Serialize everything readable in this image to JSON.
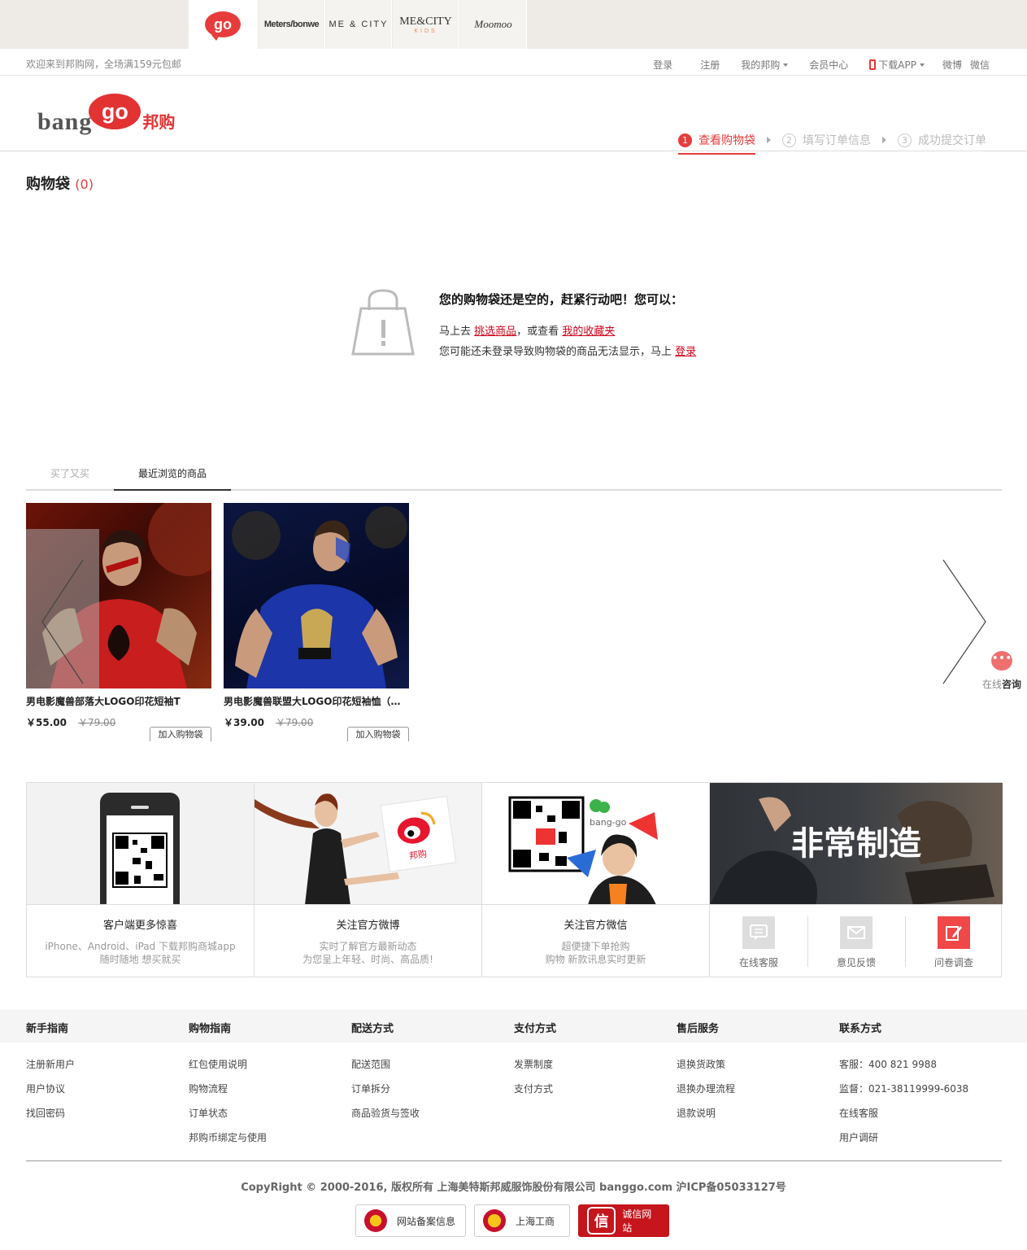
{
  "brands": {
    "go": "go",
    "metersbonwe": "Meters/bonwe",
    "mecity": "ME & CITY",
    "mecity_kids": "ME&CITY",
    "kids_sub": "KIDS",
    "moomoo": "Moomoo"
  },
  "topbar": {
    "welcome": "欢迎来到邦购网，全场满159元包邮",
    "login": "登录",
    "register": "注册",
    "my_banggo": "我的邦购",
    "member_center": "会员中心",
    "download_app": "下载APP",
    "weibo": "微博",
    "weixin": "微信"
  },
  "header": {
    "logo_bang": "bang",
    "logo_go": "go",
    "logo_cn": "邦购",
    "steps": [
      {
        "num": "1",
        "label": "查看购物袋"
      },
      {
        "num": "2",
        "label": "填写订单信息"
      },
      {
        "num": "3",
        "label": "成功提交订单"
      }
    ]
  },
  "cart": {
    "title": "购物袋",
    "count": "(0)",
    "empty_title": "您的购物袋还是空的，赶紧行动吧！您可以：",
    "line1_prefix": "马上去",
    "line1_link1": "挑选商品",
    "line1_mid": "，或查看",
    "line1_link2": "我的收藏夹",
    "line2_prefix": "您可能还未登录导致购物袋的商品无法显示，马上",
    "line2_link": "登录"
  },
  "recommend": {
    "tab_bought": "买了又买",
    "tab_recent": "最近浏览的商品",
    "add_to_cart": "加入购物袋",
    "products": [
      {
        "name": "男电影魔兽部落大LOGO印花短袖T",
        "price": "￥55.00",
        "old_price": "￥79.00"
      },
      {
        "name": "男电影魔兽联盟大LOGO印花短袖恤（预...",
        "price": "￥39.00",
        "old_price": "￥79.00"
      }
    ]
  },
  "chat": {
    "label_a": "在线",
    "label_b": "咨询"
  },
  "promo": {
    "app_title": "客户端更多惊喜",
    "app_desc1": "iPhone、Android、iPad 下载邦购商城app",
    "app_desc2": "随时随地 想买就买",
    "weibo_title": "关注官方微博",
    "weibo_desc1": "实时了解官方最新动态",
    "weibo_desc2": "为您呈上年轻、时尚、高品质!",
    "weibo_card": "邦购",
    "wechat_title": "关注官方微信",
    "wechat_desc1": "超便捷下单抢购",
    "wechat_desc2": "购物 新款讯息实时更新",
    "wechat_handle": "bang-go",
    "made_text": "非常制造",
    "svc_online": "在线客服",
    "svc_feedback": "意见反馈",
    "svc_survey": "问卷调查"
  },
  "footer": {
    "cols": [
      {
        "title": "新手指南",
        "links": [
          "注册新用户",
          "用户协议",
          "找回密码"
        ]
      },
      {
        "title": "购物指南",
        "links": [
          "红包使用说明",
          "购物流程",
          "订单状态",
          "邦购币绑定与使用"
        ]
      },
      {
        "title": "配送方式",
        "links": [
          "配送范围",
          "订单拆分",
          "商品验货与签收"
        ]
      },
      {
        "title": "支付方式",
        "links": [
          "发票制度",
          "支付方式"
        ]
      },
      {
        "title": "售后服务",
        "links": [
          "退换货政策",
          "退换办理流程",
          "退款说明"
        ]
      },
      {
        "title": "联系方式",
        "links": [
          "客服：400 821 9988",
          "监督：021-38119999-6038",
          "在线客服",
          "用户调研"
        ]
      }
    ],
    "copyright": "CopyRight © 2000-2016, 版权所有 上海美特斯邦威服饰股份有限公司 banggo.com 沪ICP备05033127号",
    "badge1": "网站备案信息",
    "badge2": "上海工商",
    "badge3": "诚信网站",
    "badge3_mark": "信"
  },
  "colors": {
    "accent": "#e83c3c",
    "link_red": "#d0021b"
  }
}
